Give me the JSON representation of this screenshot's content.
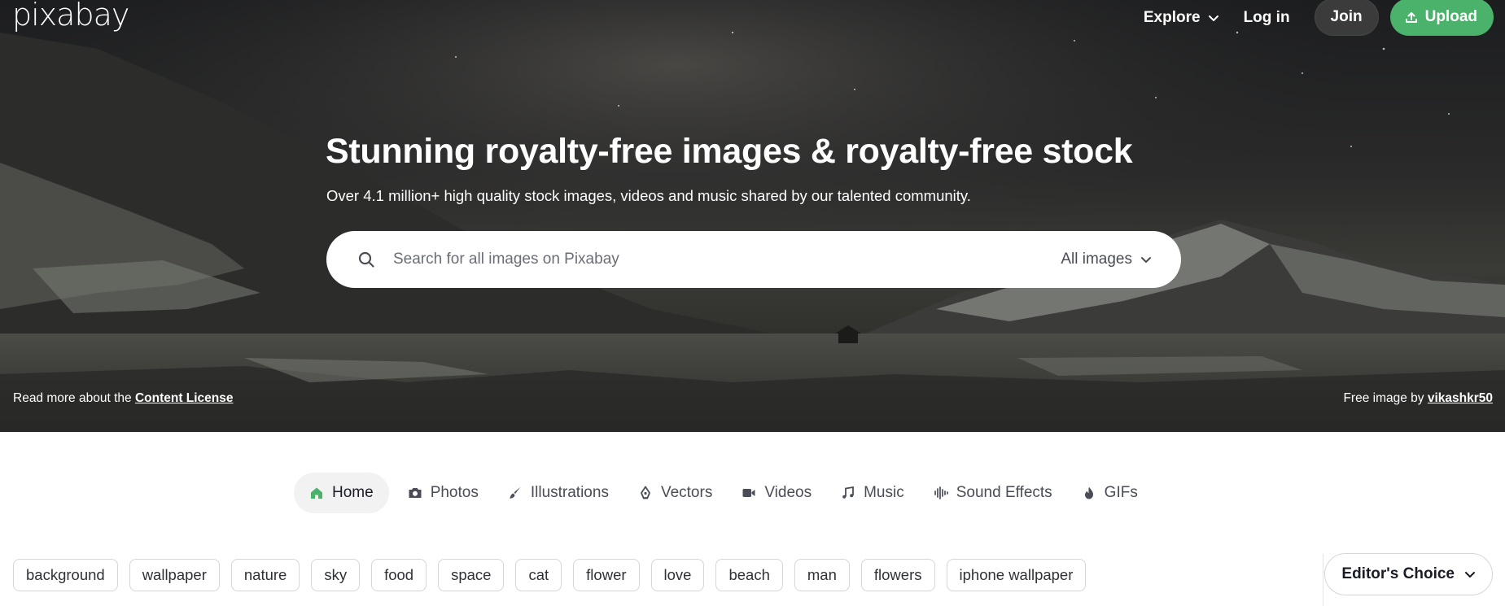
{
  "header": {
    "logo": "pixabay",
    "explore_label": "Explore",
    "login_label": "Log in",
    "join_label": "Join",
    "upload_label": "Upload"
  },
  "hero": {
    "title": "Stunning royalty-free images & royalty-free stock",
    "subtitle": "Over 4.1 million+ high quality stock images, videos and music shared by our talented community.",
    "search": {
      "placeholder": "Search for all images on Pixabay",
      "type_label": "All images"
    },
    "license_prefix": "Read more about the ",
    "license_link": "Content License",
    "credit_prefix": "Free image by ",
    "credit_user": "vikashkr50"
  },
  "tabs": [
    {
      "label": "Home",
      "icon": "home-icon"
    },
    {
      "label": "Photos",
      "icon": "camera-icon"
    },
    {
      "label": "Illustrations",
      "icon": "brush-icon"
    },
    {
      "label": "Vectors",
      "icon": "pen-tool-icon"
    },
    {
      "label": "Videos",
      "icon": "video-icon"
    },
    {
      "label": "Music",
      "icon": "music-note-icon"
    },
    {
      "label": "Sound Effects",
      "icon": "waveform-icon"
    },
    {
      "label": "GIFs",
      "icon": "flame-icon"
    }
  ],
  "tags": [
    "background",
    "wallpaper",
    "nature",
    "sky",
    "food",
    "space",
    "cat",
    "flower",
    "love",
    "beach",
    "man",
    "flowers",
    "iphone wallpaper"
  ],
  "filter": {
    "label": "Editor's Choice"
  },
  "colors": {
    "accent_green": "#4bb26b",
    "text_dark": "#191b26"
  }
}
